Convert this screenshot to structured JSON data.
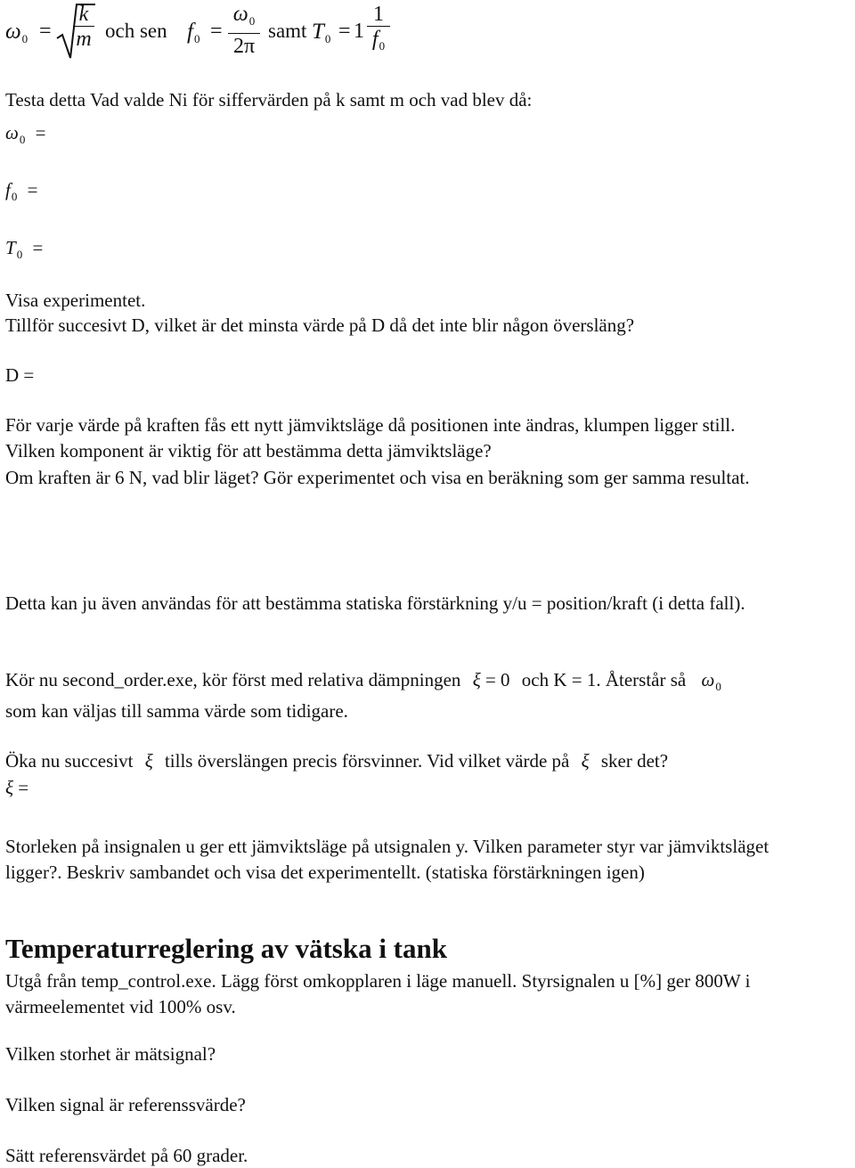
{
  "formulas": {
    "omega0_symbol": "ω",
    "f_symbol": "f",
    "T_symbol": "T",
    "sub_zero": "0",
    "equals": "=",
    "k": "k",
    "m": "m",
    "two_pi": "2π",
    "one": "1",
    "och_sen": "och sen",
    "samt": "samt"
  },
  "section1": {
    "intro": "Testa detta Vad valde Ni för siffervärden på k samt m och vad blev då:",
    "answer_omega": "ω",
    "answer_f": "f",
    "answer_T": "T",
    "visa": "Visa experimentet.",
    "tillfor": "Tillför succesivt D, vilket är det minsta värde på D då det inte blir någon översläng?",
    "d_equals": "D =",
    "for_varje": "För varje värde på kraften fås ett nytt jämviktsläge då positionen inte ändras, klumpen ligger still.",
    "vilken_komponent": "Vilken komponent är viktig för att bestämma detta jämviktsläge?",
    "om_kraften": "Om kraften är 6 N, vad blir läget? Gör experimentet och visa en beräkning som ger samma resultat.",
    "detta_kan": "Detta kan ju även användas för att bestämma statiska förstärkning y/u = position/kraft  (i detta fall).",
    "kor_nu_a": "Kör nu second_order.exe, kör först med relativa dämpningen",
    "xi": "ξ",
    "xi_zero": "= 0",
    "kor_nu_b": "och K = 1. Återstår så",
    "kor_nu_c": "som kan väljas till samma värde som tidigare.",
    "oka_a": "Öka nu succesivt",
    "oka_b": "tills överslängen precis försvinner. Vid vilket värde på",
    "oka_c": "sker det?",
    "xi_equals": "=",
    "storleken": "Storleken på insignalen u ger ett jämviktsläge på utsignalen y. Vilken parameter styr var jämviktsläget ligger?. Beskriv sambandet och visa det experimentellt. (statiska förstärkningen igen)"
  },
  "section2": {
    "heading": "Temperaturreglering av vätska i tank",
    "utga": "Utgå från temp_control.exe. Lägg först omkopplaren i läge manuell. Styrsignalen u [%] ger 800W i värmeelementet vid 100% osv.",
    "matsignal": "Vilken storhet är mätsignal?",
    "referens": "Vilken signal är referenssvärde?",
    "satt": "Sätt referensvärdet på 60 grader."
  }
}
